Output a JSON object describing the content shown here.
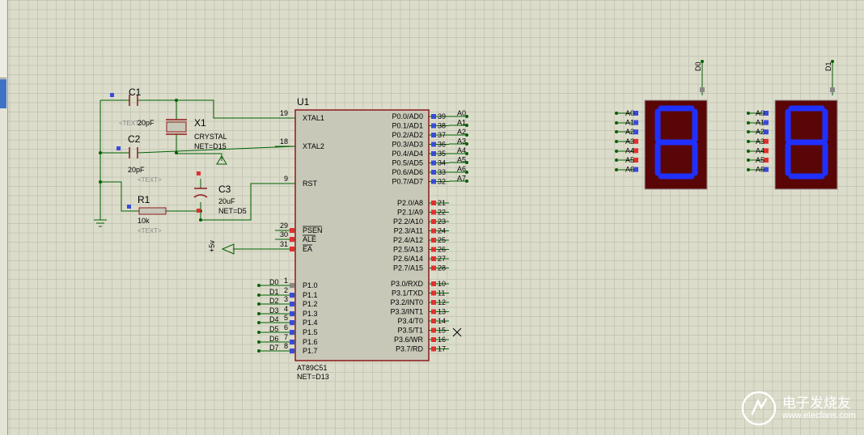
{
  "u1": {
    "ref": "U1",
    "part": "AT89C51",
    "net": "NET=D13",
    "left_pins": [
      {
        "num": "19",
        "name": "XTAL1"
      },
      {
        "num": "18",
        "name": "XTAL2"
      },
      {
        "num": "9",
        "name": "RST"
      },
      {
        "num": "29",
        "name": "PSEN"
      },
      {
        "num": "30",
        "name": "ALE"
      },
      {
        "num": "31",
        "name": "EA"
      },
      {
        "num": "1",
        "name": "P1.0",
        "net": "D0"
      },
      {
        "num": "2",
        "name": "P1.1",
        "net": "D1"
      },
      {
        "num": "3",
        "name": "P1.2",
        "net": "D2"
      },
      {
        "num": "4",
        "name": "P1.3",
        "net": "D3"
      },
      {
        "num": "5",
        "name": "P1.4",
        "net": "D4"
      },
      {
        "num": "6",
        "name": "P1.5",
        "net": "D5"
      },
      {
        "num": "7",
        "name": "P1.6",
        "net": "D6"
      },
      {
        "num": "8",
        "name": "P1.7",
        "net": "D7"
      }
    ],
    "right_pins": [
      {
        "num": "39",
        "name": "P0.0/AD0",
        "net": "A0"
      },
      {
        "num": "38",
        "name": "P0.1/AD1",
        "net": "A1"
      },
      {
        "num": "37",
        "name": "P0.2/AD2",
        "net": "A2"
      },
      {
        "num": "36",
        "name": "P0.3/AD3",
        "net": "A3"
      },
      {
        "num": "35",
        "name": "P0.4/AD4",
        "net": "A4"
      },
      {
        "num": "34",
        "name": "P0.5/AD5",
        "net": "A5"
      },
      {
        "num": "33",
        "name": "P0.6/AD6",
        "net": "A6"
      },
      {
        "num": "32",
        "name": "P0.7/AD7",
        "net": "A7"
      },
      {
        "num": "21",
        "name": "P2.0/A8"
      },
      {
        "num": "22",
        "name": "P2.1/A9"
      },
      {
        "num": "23",
        "name": "P2.2/A10"
      },
      {
        "num": "24",
        "name": "P2.3/A11"
      },
      {
        "num": "25",
        "name": "P2.4/A12"
      },
      {
        "num": "26",
        "name": "P2.5/A13"
      },
      {
        "num": "27",
        "name": "P2.6/A14"
      },
      {
        "num": "28",
        "name": "P2.7/A15"
      },
      {
        "num": "10",
        "name": "P3.0/RXD"
      },
      {
        "num": "11",
        "name": "P3.1/TXD"
      },
      {
        "num": "12",
        "name": "P3.2/INT0"
      },
      {
        "num": "13",
        "name": "P3.3/INT1"
      },
      {
        "num": "14",
        "name": "P3.4/T0"
      },
      {
        "num": "15",
        "name": "P3.5/T1"
      },
      {
        "num": "16",
        "name": "P3.6/WR"
      },
      {
        "num": "17",
        "name": "P3.7/RD"
      }
    ]
  },
  "c1": {
    "ref": "C1",
    "value": "20pF",
    "text": "<TEXT>"
  },
  "c2": {
    "ref": "C2",
    "value": "20pF",
    "text": "<TEXT>"
  },
  "c3": {
    "ref": "C3",
    "value": "20uF",
    "net": "NET=D5"
  },
  "x1": {
    "ref": "X1",
    "value": "CRYSTAL",
    "net": "NET=D15"
  },
  "r1": {
    "ref": "R1",
    "value": "10k",
    "text": "<TEXT>"
  },
  "power": {
    "label": "+5v"
  },
  "displays": [
    {
      "common": "D0",
      "inputs": [
        "A0",
        "A1",
        "A2",
        "A3",
        "A4",
        "A5",
        "A6"
      ],
      "digit": "8"
    },
    {
      "common": "D1",
      "inputs": [
        "A0",
        "A1",
        "A2",
        "A3",
        "A4",
        "A5",
        "A6"
      ],
      "digit": "8"
    }
  ],
  "watermark": {
    "text": "电子发烧友",
    "url": "www.elecfans.com"
  },
  "colors": {
    "canvas": "#dcdccb",
    "chip_fill": "#c8c8b8",
    "chip_outline": "#8b1a1a",
    "wire": "#006100",
    "pin_blue": "#3a4bd8",
    "pin_red": "#e03030",
    "display_body": "#5a0606",
    "segment_on": "#2030ff"
  }
}
